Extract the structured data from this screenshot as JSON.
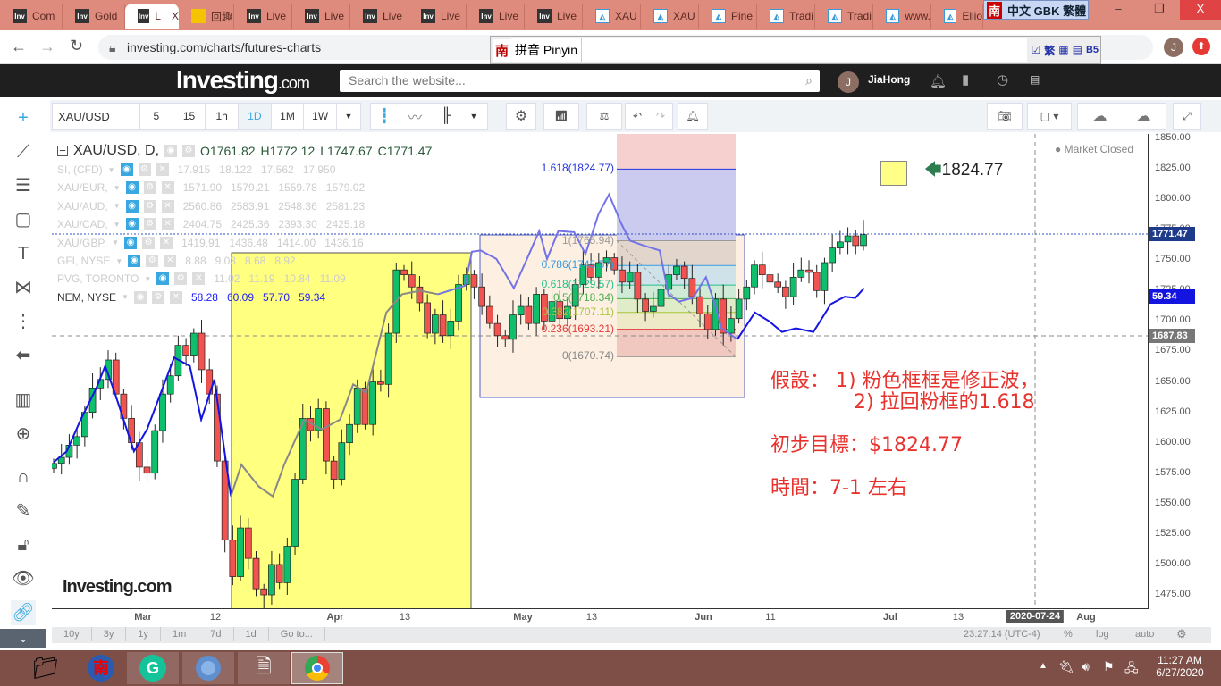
{
  "browser": {
    "tabs": [
      {
        "label": "Com",
        "icon": "Inv"
      },
      {
        "label": "Gold",
        "icon": "Inv"
      },
      {
        "label": "L",
        "icon": "Inv",
        "active": true
      },
      {
        "label": "回趣",
        "icon": "bulb"
      },
      {
        "label": "Live",
        "icon": "Inv"
      },
      {
        "label": "Live",
        "icon": "Inv"
      },
      {
        "label": "Live",
        "icon": "Inv"
      },
      {
        "label": "Live",
        "icon": "Inv"
      },
      {
        "label": "Live",
        "icon": "Inv"
      },
      {
        "label": "Live",
        "icon": "Inv"
      },
      {
        "label": "XAU",
        "icon": "tv"
      },
      {
        "label": "XAU",
        "icon": "tv"
      },
      {
        "label": "Pine",
        "icon": "tv"
      },
      {
        "label": "Tradi",
        "icon": "tv"
      },
      {
        "label": "Tradi",
        "icon": "tv"
      },
      {
        "label": "www.",
        "icon": "tv"
      },
      {
        "label": "Ellio",
        "icon": "tv"
      }
    ],
    "tab_close": "X",
    "url": "investing.com/charts/futures-charts",
    "ime": {
      "badge": "南",
      "text": "中文 GBK 繁體"
    },
    "pinyin": {
      "badge": "南",
      "label": "拼音 Pinyin",
      "trad": "繁",
      "b5": "B5"
    },
    "profile_initial": "J"
  },
  "site": {
    "logo": "Investing",
    "logo_suffix": ".com",
    "search_placeholder": "Search the website...",
    "user": "JiaHong",
    "user_initial": "J"
  },
  "toolbar": {
    "symbol": "XAU/USD",
    "intervals": [
      "5",
      "15",
      "1h",
      "1D",
      "1M",
      "1W"
    ],
    "active_interval": "1D"
  },
  "legend": {
    "main": {
      "symbol": "XAU/USD, D,",
      "o": "O1761.82",
      "h": "H1772.12",
      "l": "L1747.67",
      "c": "C1771.47"
    },
    "overlays": [
      {
        "name": "SI, (CFD)",
        "values": [
          "17.915",
          "18.122",
          "17.562",
          "17.950"
        ]
      },
      {
        "name": "XAU/EUR,",
        "values": [
          "1571.90",
          "1579.21",
          "1559.78",
          "1579.02"
        ]
      },
      {
        "name": "XAU/AUD,",
        "values": [
          "2560.86",
          "2583.91",
          "2548.36",
          "2581.23"
        ]
      },
      {
        "name": "XAU/CAD,",
        "values": [
          "2404.75",
          "2425.36",
          "2393.30",
          "2425.18"
        ]
      },
      {
        "name": "XAU/GBP,",
        "values": [
          "1419.91",
          "1436.48",
          "1414.00",
          "1436.16"
        ]
      },
      {
        "name": "GFI, NYSE",
        "values": [
          "8.88",
          "9.03",
          "8.68",
          "8.92"
        ]
      },
      {
        "name": "PVG, TORONTO",
        "values": [
          "11.02",
          "11.19",
          "10.84",
          "11.09"
        ]
      },
      {
        "name": "NEM, NYSE",
        "values": [
          "58.28",
          "60.09",
          "57.70",
          "59.34"
        ],
        "active": true
      }
    ],
    "market_status": "Market Closed"
  },
  "chart_data": {
    "type": "candlestick",
    "ylim": [
      1462,
      1853
    ],
    "y_ticks": [
      1475,
      1500,
      1525,
      1550,
      1575,
      1600,
      1625,
      1650,
      1675,
      1700,
      1725,
      1750,
      1775,
      1800,
      1825,
      1850
    ],
    "y_tick_labels": [
      "1475.00",
      "1500.00",
      "1525.00",
      "1550.00",
      "1575.00",
      "1600.00",
      "1625.00",
      "1650.00",
      "1675.00",
      "1700.00",
      "1725.00",
      "1750.00",
      "1775.00",
      "1800.00",
      "1825.00",
      "1850.00"
    ],
    "x_ticks": [
      "Mar",
      "12",
      "Apr",
      "13",
      "May",
      "13",
      "Jun",
      "11",
      "Jul",
      "13",
      "Aug"
    ],
    "crosshair_date": "2020-07-24",
    "closes": [
      1583,
      1588,
      1598,
      1605,
      1625,
      1645,
      1652,
      1668,
      1640,
      1620,
      1600,
      1580,
      1575,
      1610,
      1640,
      1655,
      1680,
      1672,
      1690,
      1660,
      1640,
      1585,
      1520,
      1490,
      1530,
      1505,
      1480,
      1475,
      1500,
      1485,
      1515,
      1570,
      1620,
      1610,
      1628,
      1585,
      1570,
      1600,
      1615,
      1645,
      1615,
      1650,
      1648,
      1690,
      1742,
      1738,
      1728,
      1715,
      1690,
      1705,
      1688,
      1700,
      1730,
      1738,
      1728,
      1712,
      1698,
      1688,
      1685,
      1705,
      1712,
      1698,
      1722,
      1700,
      1716,
      1702,
      1712,
      1730,
      1746,
      1736,
      1748,
      1752,
      1742,
      1732,
      1740,
      1718,
      1708,
      1712,
      1726,
      1738,
      1745,
      1735,
      1720,
      1706,
      1693,
      1718,
      1690,
      1702,
      1718,
      1728,
      1746,
      1738,
      1732,
      1728,
      1720,
      1736,
      1742,
      1740,
      1725,
      1748,
      1760,
      1765,
      1770,
      1762,
      1771
    ],
    "overlay_line": [
      [
        0,
        1584
      ],
      [
        1.5,
        1593
      ],
      [
        3.1,
        1619
      ],
      [
        4.9,
        1645
      ],
      [
        5.9,
        1663
      ],
      [
        7,
        1641
      ],
      [
        9.2,
        1593
      ],
      [
        10.7,
        1611
      ],
      [
        13.8,
        1670
      ],
      [
        15.6,
        1663
      ],
      [
        16.9,
        1619
      ],
      [
        18.4,
        1652
      ],
      [
        20.3,
        1556
      ],
      [
        21.5,
        1582
      ],
      [
        23.5,
        1564
      ],
      [
        25.1,
        1556
      ],
      [
        26.4,
        1582
      ],
      [
        28.7,
        1619
      ],
      [
        30.7,
        1611
      ],
      [
        32.8,
        1619
      ],
      [
        34.3,
        1648
      ],
      [
        35.8,
        1641
      ],
      [
        38.1,
        1707
      ],
      [
        39.9,
        1722
      ],
      [
        42,
        1725
      ],
      [
        44,
        1722
      ],
      [
        47.1,
        1729
      ],
      [
        47.9,
        1757
      ],
      [
        48.9,
        1758
      ],
      [
        50.7,
        1751
      ],
      [
        52.7,
        1727
      ],
      [
        54.2,
        1751
      ],
      [
        55.6,
        1774
      ],
      [
        56.5,
        1751
      ],
      [
        57.8,
        1774
      ],
      [
        59.6,
        1773
      ],
      [
        60.9,
        1755
      ],
      [
        62.4,
        1788
      ],
      [
        63.6,
        1804
      ],
      [
        65,
        1780
      ],
      [
        66,
        1766
      ],
      [
        67.6,
        1762
      ],
      [
        69.4,
        1758
      ],
      [
        70.4,
        1722
      ],
      [
        71.6,
        1716
      ],
      [
        73.2,
        1719
      ],
      [
        74.7,
        1736
      ],
      [
        75.7,
        1714
      ],
      [
        76.5,
        1694
      ],
      [
        78.3,
        1685
      ],
      [
        80.3,
        1707
      ],
      [
        81.9,
        1700
      ],
      [
        83.4,
        1691
      ],
      [
        85,
        1694
      ],
      [
        87,
        1691
      ],
      [
        89,
        1714
      ],
      [
        90.6,
        1720
      ],
      [
        91.8,
        1719
      ],
      [
        92.8,
        1727
      ]
    ],
    "price_labels": {
      "last": "1771.47",
      "nem": "59.34",
      "line": "1687.83"
    },
    "fib": {
      "levels": [
        {
          "r": "1",
          "p": 1765.94,
          "label": "1(1765.94)",
          "c": "#999"
        },
        {
          "r": "0.786",
          "p": 1745.57,
          "label": "0.786(1745.57)",
          "c": "#3a9ad9"
        },
        {
          "r": "0.618",
          "p": 1729.57,
          "label": "0.618(1729.57)",
          "c": "#22c08a"
        },
        {
          "r": "0.5",
          "p": 1718.34,
          "label": "0.5(1718.34)",
          "c": "#4caf50"
        },
        {
          "r": "0.382",
          "p": 1707.11,
          "label": "0.382(1707.11)",
          "c": "#a8c43a"
        },
        {
          "r": "0.236",
          "p": 1693.21,
          "label": "0.236(1693.21)",
          "c": "#e53935"
        },
        {
          "r": "0",
          "p": 1670.74,
          "label": "0(1670.74)",
          "c": "#888"
        }
      ],
      "ext": {
        "label": "1.618(1824.77)",
        "p": 1824.77
      }
    },
    "target_label": "1824.77"
  },
  "notes": [
    "假設： 1) 粉色框框是修正波，",
    "2) 拉回粉框的1.618",
    "初步目標：$1824.77",
    "時間：7-1 左右"
  ],
  "watermark": "Investing.com",
  "bottom": {
    "ranges": [
      "10y",
      "3y",
      "1y",
      "1m",
      "7d",
      "1d",
      "Go to..."
    ],
    "time": "23:27:14 (UTC-4)",
    "pct": "%",
    "log": "log",
    "auto": "auto"
  },
  "taskbar": {
    "time": "11:27 AM",
    "date": "6/27/2020"
  },
  "colors": {
    "up": "#0fbf6b",
    "down": "#f05350",
    "accent": "#3aa8e0",
    "note": "#e8322d"
  }
}
